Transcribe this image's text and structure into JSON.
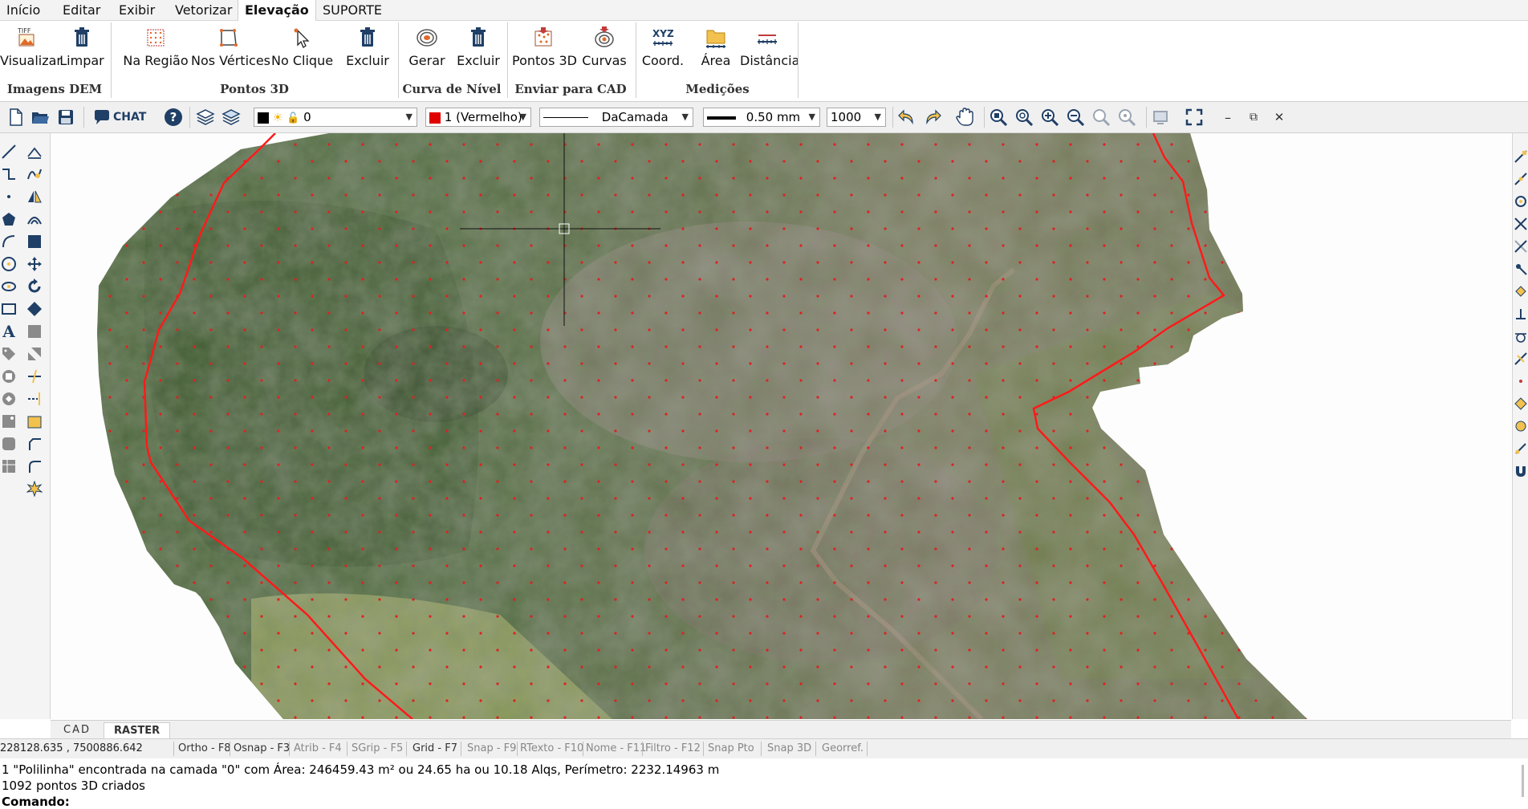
{
  "menu": {
    "tabs": [
      "Início",
      "Editar",
      "Exibir",
      "Vetorizar",
      "Elevação",
      "SUPORTE"
    ],
    "active": "Elevação"
  },
  "ribbon": {
    "groups": [
      {
        "title": "Imagens DEM",
        "buttons": [
          {
            "label": "Visualizar",
            "icon": "tiff-image-icon"
          },
          {
            "label": "Limpar",
            "icon": "trash-icon"
          }
        ]
      },
      {
        "title": "Pontos 3D",
        "buttons": [
          {
            "label": "Na Região",
            "icon": "grid-region-icon"
          },
          {
            "label": "Nos Vértices",
            "icon": "vertices-icon"
          },
          {
            "label": "No Clique",
            "icon": "click-cursor-icon"
          },
          {
            "label": "Excluir",
            "icon": "trash-icon"
          }
        ]
      },
      {
        "title": "Curva de Nível",
        "buttons": [
          {
            "label": "Gerar",
            "icon": "contour-icon"
          },
          {
            "label": "Excluir",
            "icon": "trash-icon"
          }
        ]
      },
      {
        "title": "Enviar para CAD",
        "buttons": [
          {
            "label": "Pontos 3D",
            "icon": "points-cad-icon"
          },
          {
            "label": "Curvas",
            "icon": "curves-cad-icon"
          }
        ]
      },
      {
        "title": "Medições",
        "buttons": [
          {
            "label": "Coord.",
            "icon": "xyz-icon",
            "icon_text": "XYZ"
          },
          {
            "label": "Área",
            "icon": "area-icon"
          },
          {
            "label": "Distância",
            "icon": "distance-icon"
          }
        ]
      }
    ]
  },
  "toolbar": {
    "chat_label": "CHAT",
    "layer_value": "0",
    "color_value": "1 (Vermelho)",
    "linetype_value": "DaCamada",
    "lineweight_value": "0.50 mm",
    "scale_value": "1000"
  },
  "view_tabs": [
    "CAD",
    "RASTER"
  ],
  "active_view_tab": "RASTER",
  "status": {
    "coords": "228128.635 , 7500886.642",
    "toggles": [
      {
        "label": "Ortho - F8",
        "on": true
      },
      {
        "label": "Osnap - F3",
        "on": true
      },
      {
        "label": "Atrib - F4",
        "on": false
      },
      {
        "label": "SGrip - F5",
        "on": false
      },
      {
        "label": "Grid - F7",
        "on": true
      },
      {
        "label": "Snap - F9",
        "on": false
      },
      {
        "label": "RTexto - F10",
        "on": false
      },
      {
        "label": "Nome - F11",
        "on": false
      },
      {
        "label": "Filtro - F12",
        "on": false
      },
      {
        "label": "Snap Pto",
        "on": false
      },
      {
        "label": "Snap 3D",
        "on": false
      },
      {
        "label": "Georref.",
        "on": false
      }
    ]
  },
  "console": {
    "lines": [
      " 1 \"Polilinha\" encontrada na camada \"0\" com  Área: 246459.43 m² ou 24.65 ha ou 10.18 Alqs, Perímetro: 2232.14963 m",
      "1092 pontos 3D criados",
      "Comando:"
    ]
  },
  "colors": {
    "polyline": "#ff1a1a",
    "points": "#e02020",
    "accent_blue": "#1565c0"
  }
}
